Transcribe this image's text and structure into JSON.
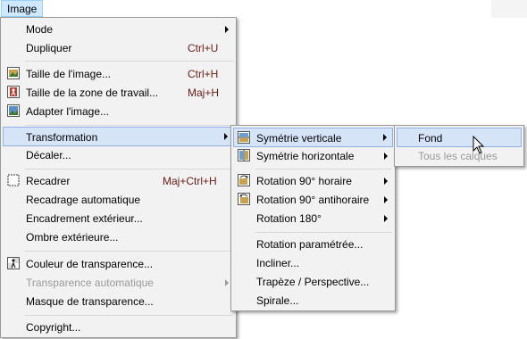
{
  "menubar": {
    "title": "Image"
  },
  "main_menu": {
    "items": [
      {
        "label": "Mode",
        "shortcut": ""
      },
      {
        "label": "Dupliquer",
        "shortcut": "Ctrl+U"
      },
      {
        "label": "Taille de l'image...",
        "shortcut": "Ctrl+H"
      },
      {
        "label": "Taille de la zone de travail...",
        "shortcut": "Maj+H"
      },
      {
        "label": "Adapter l'image...",
        "shortcut": ""
      },
      {
        "label": "Transformation",
        "shortcut": ""
      },
      {
        "label": "Décaler...",
        "shortcut": ""
      },
      {
        "label": "Recadrer",
        "shortcut": "Maj+Ctrl+H"
      },
      {
        "label": "Recadrage automatique",
        "shortcut": ""
      },
      {
        "label": "Encadrement extérieur...",
        "shortcut": ""
      },
      {
        "label": "Ombre extérieure...",
        "shortcut": ""
      },
      {
        "label": "Couleur de transparence...",
        "shortcut": ""
      },
      {
        "label": "Transparence automatique",
        "shortcut": ""
      },
      {
        "label": "Masque de transparence...",
        "shortcut": ""
      },
      {
        "label": "Copyright...",
        "shortcut": ""
      }
    ]
  },
  "transform_menu": {
    "items": [
      {
        "label": "Symétrie verticale"
      },
      {
        "label": "Symétrie horizontale"
      },
      {
        "label": "Rotation 90° horaire"
      },
      {
        "label": "Rotation 90° antihoraire"
      },
      {
        "label": "Rotation 180°"
      },
      {
        "label": "Rotation paramétrée..."
      },
      {
        "label": "Incliner..."
      },
      {
        "label": "Trapèze / Perspective..."
      },
      {
        "label": "Spirale..."
      }
    ]
  },
  "target_menu": {
    "items": [
      {
        "label": "Fond"
      },
      {
        "label": "Tous les calques"
      }
    ]
  },
  "colors": {
    "highlight_bg": "#d5e4f7",
    "highlight_border": "#8db2e3",
    "shortcut_text": "#6b1c14",
    "disabled_text": "#9a9a9a"
  }
}
